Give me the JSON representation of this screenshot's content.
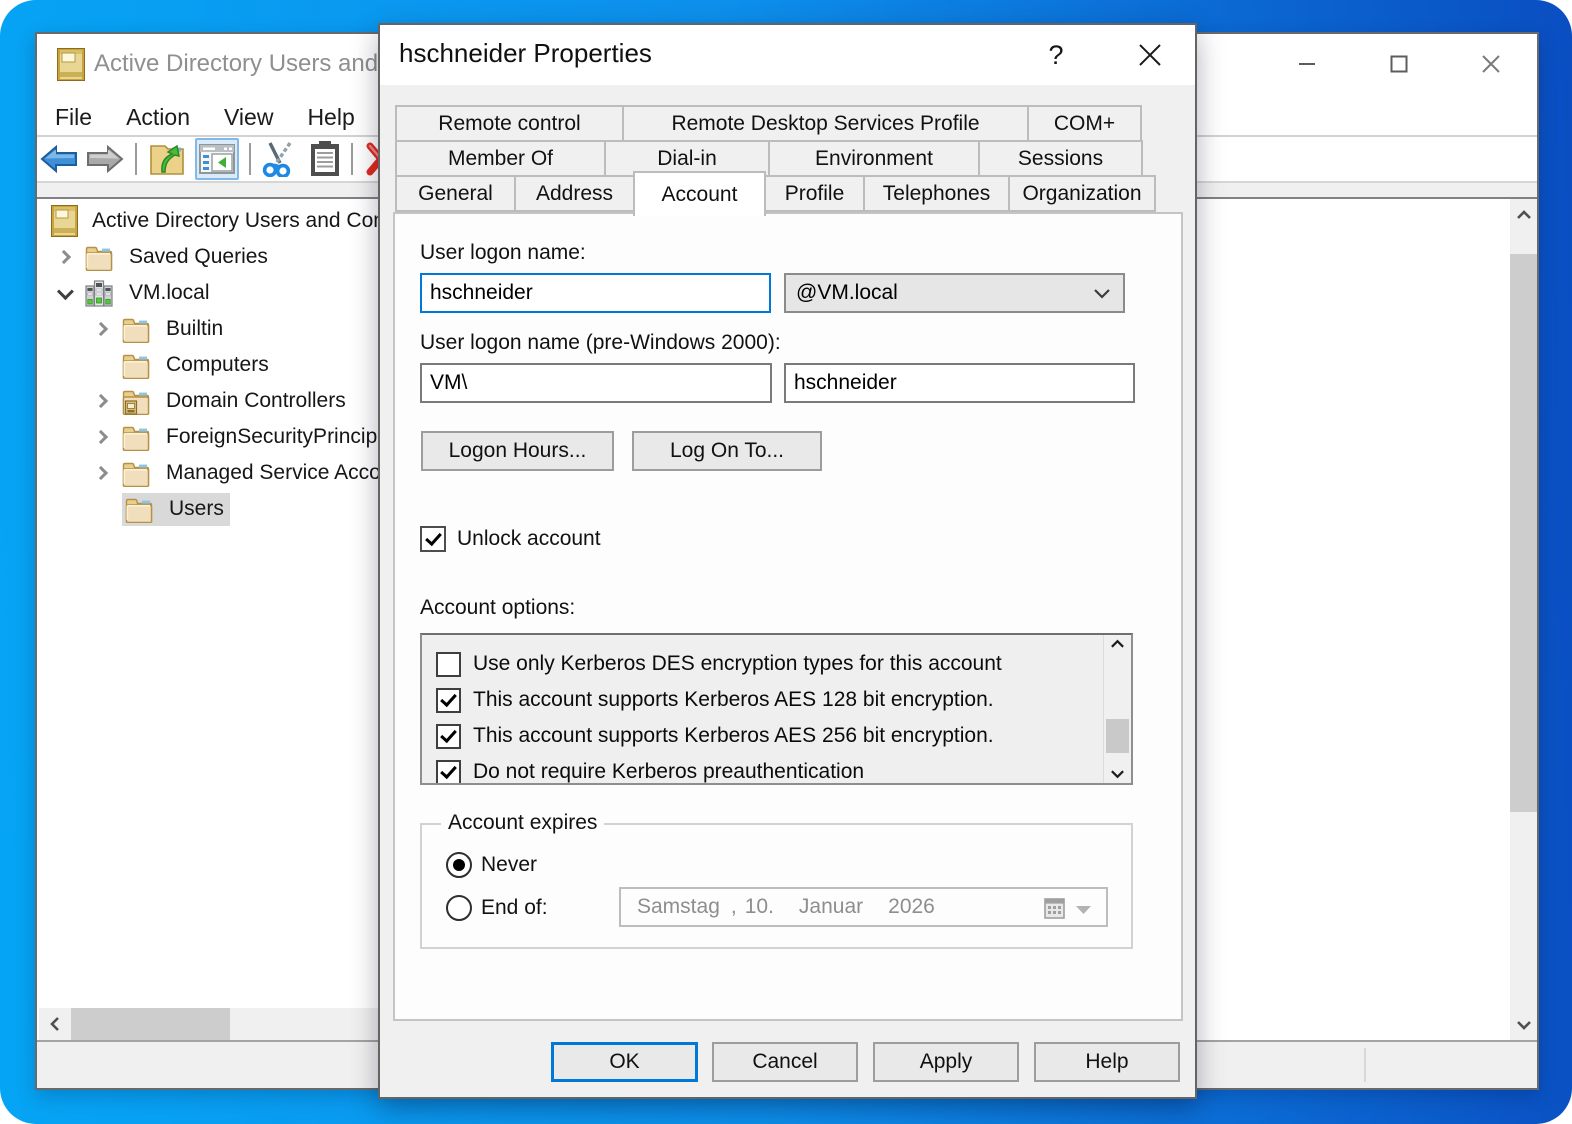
{
  "main_window": {
    "title": "Active Directory Users and Computers",
    "menu": [
      "File",
      "Action",
      "View",
      "Help"
    ],
    "toolbar_icons": [
      "back",
      "forward",
      "export-folder",
      "console-tree-toggle",
      "cut",
      "paste",
      "delete"
    ],
    "tree": {
      "items": [
        {
          "label": "Active Directory Users and Computers",
          "level": 0,
          "chevron": "none",
          "icon": "directory-book"
        },
        {
          "label": "Saved Queries",
          "level": 1,
          "chevron": "collapsed",
          "icon": "folder"
        },
        {
          "label": "VM.local",
          "level": 1,
          "chevron": "expanded",
          "icon": "domain"
        },
        {
          "label": "Builtin",
          "level": 2,
          "chevron": "collapsed",
          "icon": "folder"
        },
        {
          "label": "Computers",
          "level": 2,
          "chevron": "none",
          "icon": "folder"
        },
        {
          "label": "Domain Controllers",
          "level": 2,
          "chevron": "collapsed",
          "icon": "folder-badge"
        },
        {
          "label": "ForeignSecurityPrincipals",
          "level": 2,
          "chevron": "collapsed",
          "icon": "folder"
        },
        {
          "label": "Managed Service Accounts",
          "level": 2,
          "chevron": "collapsed",
          "icon": "folder"
        },
        {
          "label": "Users",
          "level": 2,
          "chevron": "none",
          "icon": "folder",
          "selected": true
        }
      ]
    }
  },
  "dialog": {
    "title": "hschneider Properties",
    "help_glyph": "?",
    "close_glyph": "✕",
    "tab_rows": [
      {
        "tabs": [
          {
            "label": "Remote control"
          },
          {
            "label": "Remote Desktop Services Profile"
          },
          {
            "label": "COM+"
          }
        ]
      },
      {
        "tabs": [
          {
            "label": "Member Of"
          },
          {
            "label": "Dial-in"
          },
          {
            "label": "Environment"
          },
          {
            "label": "Sessions"
          }
        ]
      },
      {
        "tabs": [
          {
            "label": "General"
          },
          {
            "label": "Address"
          },
          {
            "label": "Account",
            "active": true
          },
          {
            "label": "Profile"
          },
          {
            "label": "Telephones"
          },
          {
            "label": "Organization"
          }
        ]
      }
    ],
    "account_tab": {
      "logon_name_label": "User logon name:",
      "logon_name_value": "hschneider",
      "domain_suffix_value": "@VM.local",
      "pre2000_label": "User logon name (pre-Windows 2000):",
      "pre2000_domain_value": "VM\\",
      "pre2000_name_value": "hschneider",
      "logon_hours_button": "Logon Hours...",
      "log_on_to_button": "Log On To...",
      "unlock_account_label": "Unlock account",
      "unlock_account_checked": true,
      "account_options_label": "Account options:",
      "account_options": [
        {
          "label": "Use only Kerberos DES encryption types for this account",
          "checked": false
        },
        {
          "label": "This account supports Kerberos AES 128 bit encryption.",
          "checked": true
        },
        {
          "label": "This account supports Kerberos AES 256 bit encryption.",
          "checked": true
        },
        {
          "label": "Do not require Kerberos preauthentication",
          "checked": true
        }
      ],
      "account_expires_label": "Account expires",
      "expire_never_label": "Never",
      "expire_never_selected": true,
      "expire_end_of_label": "End of:",
      "expire_date": {
        "weekday": "Samstag",
        "comma": ",",
        "day": "10.",
        "month": "Januar",
        "year": "2026"
      }
    },
    "buttons": {
      "ok": "OK",
      "cancel": "Cancel",
      "apply": "Apply",
      "help": "Help"
    }
  },
  "colors": {
    "accent_blue": "#0078d7",
    "desktop_gradient_start": "#22a5f2",
    "desktop_gradient_end": "#0b55c8",
    "selection_gray": "#d9d9d9"
  }
}
